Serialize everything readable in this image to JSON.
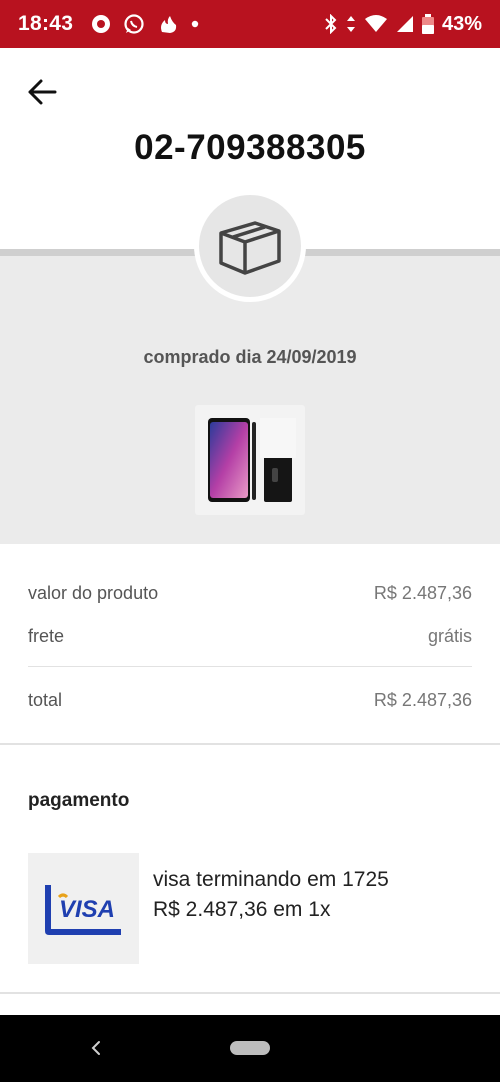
{
  "status_bar": {
    "time": "18:43",
    "battery": "43%",
    "icons": [
      "opera-icon",
      "whatsapp-icon",
      "flame-icon",
      "dot-icon",
      "bluetooth-icon",
      "data-arrows-icon",
      "wifi-icon",
      "signal-icon",
      "battery-icon"
    ],
    "background": "#b8121f"
  },
  "header": {
    "back_icon": "arrow-left-icon",
    "order_number": "02-709388305"
  },
  "summary": {
    "box_icon": "package-box-icon",
    "purchase_date": "comprado dia 24/09/2019",
    "product_image": "phone-product-image"
  },
  "prices": {
    "product_label": "valor do produto",
    "product_value": "R$ 2.487,36",
    "shipping_label": "frete",
    "shipping_value": "grátis",
    "total_label": "total",
    "total_value": "R$ 2.487,36"
  },
  "payment": {
    "heading": "pagamento",
    "card_brand": "VISA",
    "card_icon": "visa-card-icon",
    "card_description": "visa terminando em 1725",
    "card_amount": "R$ 2.487,36 em 1x"
  },
  "nav_bar": {
    "back_icon": "nav-back-icon",
    "home_icon": "home-pill-icon"
  }
}
